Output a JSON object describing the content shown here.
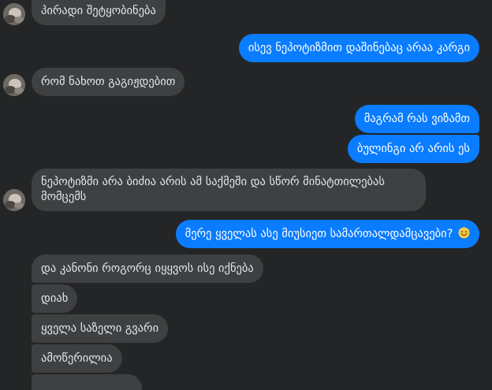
{
  "messages": [
    {
      "id": "m1",
      "side": "in",
      "text": "პირადი შეტყობინება"
    },
    {
      "id": "m2",
      "side": "out",
      "text": "ისევ ნეპოტიზმით დაშინებაც არაა კარგი"
    },
    {
      "id": "m3",
      "side": "in",
      "text": "რომ ნახოთ გაგიჟდებით"
    },
    {
      "id": "m4",
      "side": "out",
      "text": "მაგრამ რას ვიზამთ"
    },
    {
      "id": "m5",
      "side": "out",
      "text": "ბულინგი არ არის ეს"
    },
    {
      "id": "m6",
      "side": "in",
      "text": "ნეპოტიზმი არა ბიძია არის ამ საქმეში და სწორ მინატთილებას მომცემს"
    },
    {
      "id": "m7",
      "side": "out",
      "text": "მერე ყველას ასე მიუსიეთ სამართალდამცავები?",
      "emoji": "smiling-face"
    },
    {
      "id": "m8",
      "side": "in",
      "text": "და კანონი როგორც იყყვოს ისე იქნება"
    },
    {
      "id": "m9",
      "side": "in",
      "text": "დიახ"
    },
    {
      "id": "m10",
      "side": "in",
      "text": "ყველა საზელი გვარი"
    },
    {
      "id": "m11",
      "side": "in",
      "text": "ამოწერილია"
    }
  ],
  "colors": {
    "background": "#242526",
    "incoming_bubble": "#3e4042",
    "outgoing_bubble": "#0a7cff",
    "text": "#e4e6eb"
  },
  "icons": {
    "avatar": "contact-avatar",
    "emoji": "smiling-face-emoji"
  }
}
